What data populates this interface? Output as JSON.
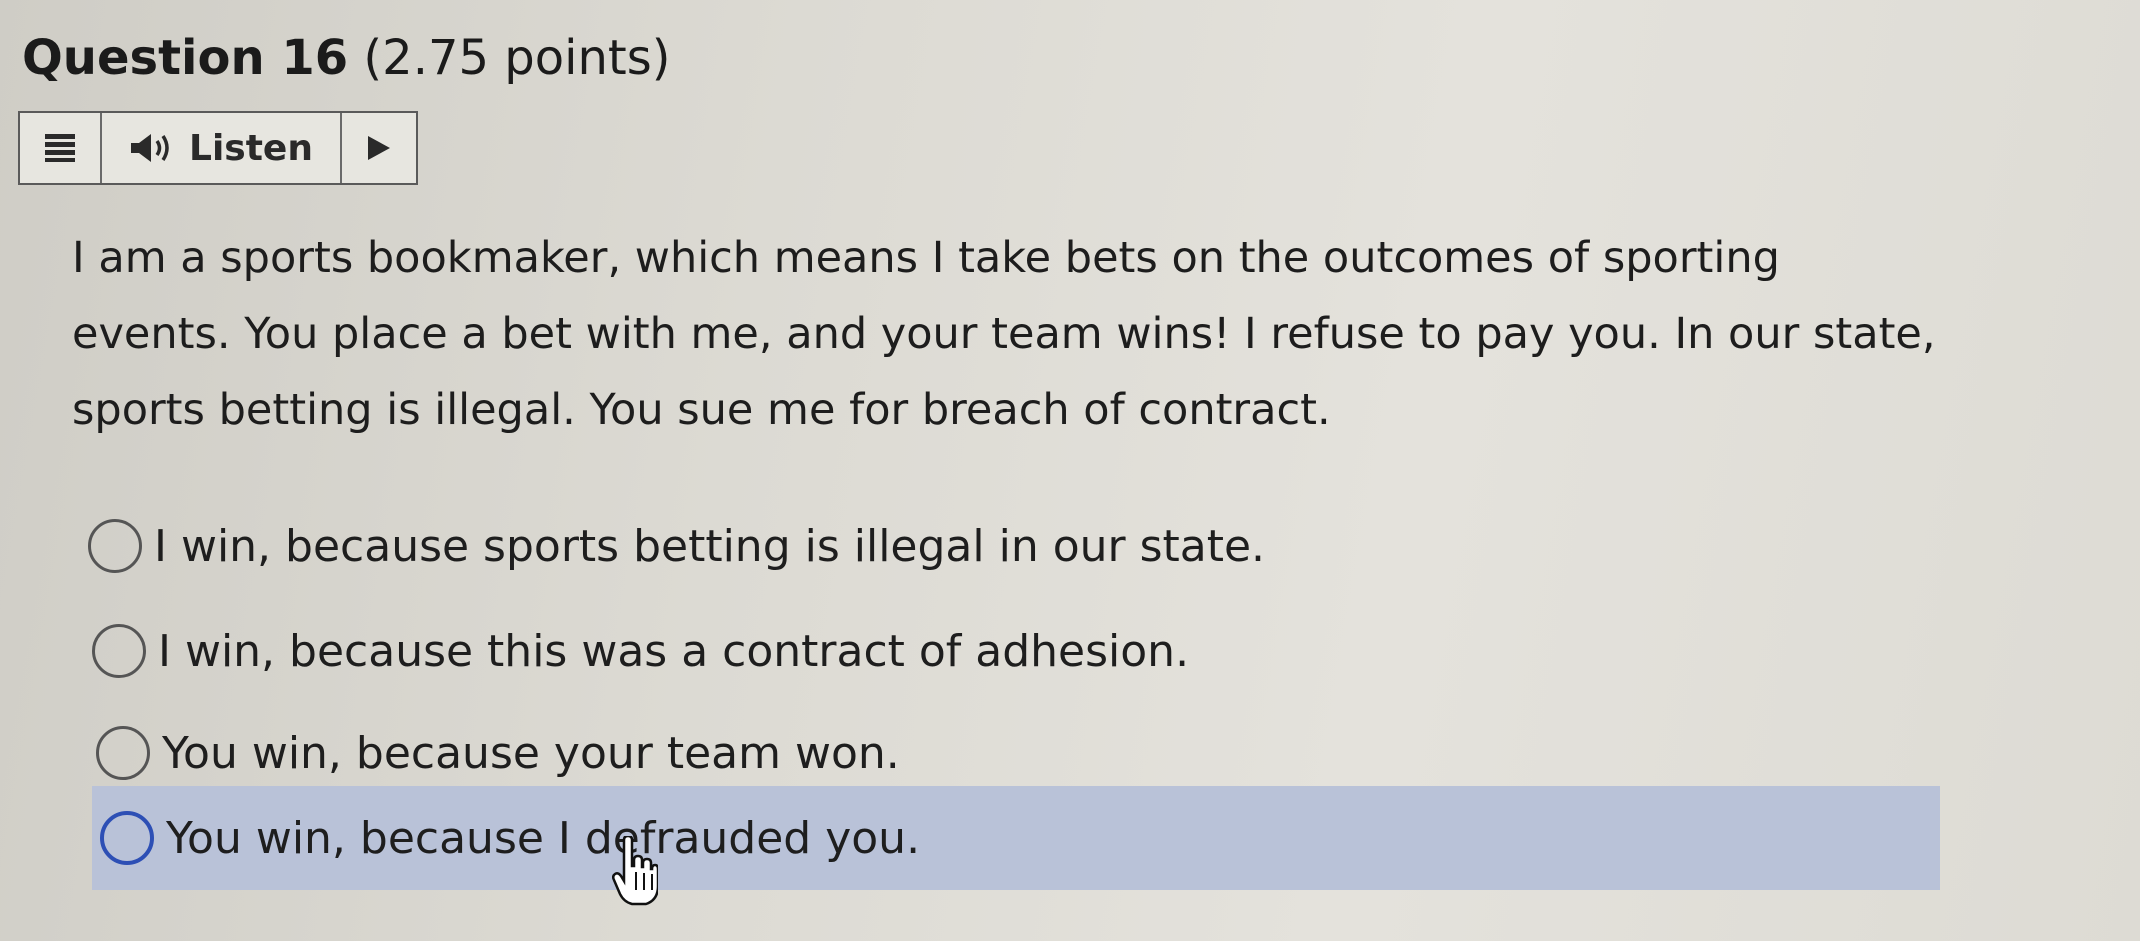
{
  "question": {
    "number": "Question 16",
    "points": "(2.75 points)"
  },
  "listen_toolbar": {
    "menu_icon": "menu-icon",
    "speaker_icon": "speaker-icon",
    "listen_label": "Listen",
    "play_icon": "play-icon"
  },
  "prompt": {
    "lines": [
      "I am a sports bookmaker, which means I take bets on the outcomes of sporting",
      "events. You place a bet with me, and your team wins! I refuse to pay you. In our state,",
      "sports betting is illegal. You sue me for breach of contract."
    ]
  },
  "choices": [
    {
      "label": "I win, because sports betting is illegal in our state.",
      "selected": false
    },
    {
      "label": "I win, because this was a contract of adhesion.",
      "selected": false
    },
    {
      "label": "You win, because your team won.",
      "selected": false
    },
    {
      "label": "You win, because I defrauded you.",
      "selected": false,
      "hovered": true
    }
  ],
  "colors": {
    "hover_highlight": "#b9c2d8",
    "hover_radio_border": "#2d4fb5"
  }
}
